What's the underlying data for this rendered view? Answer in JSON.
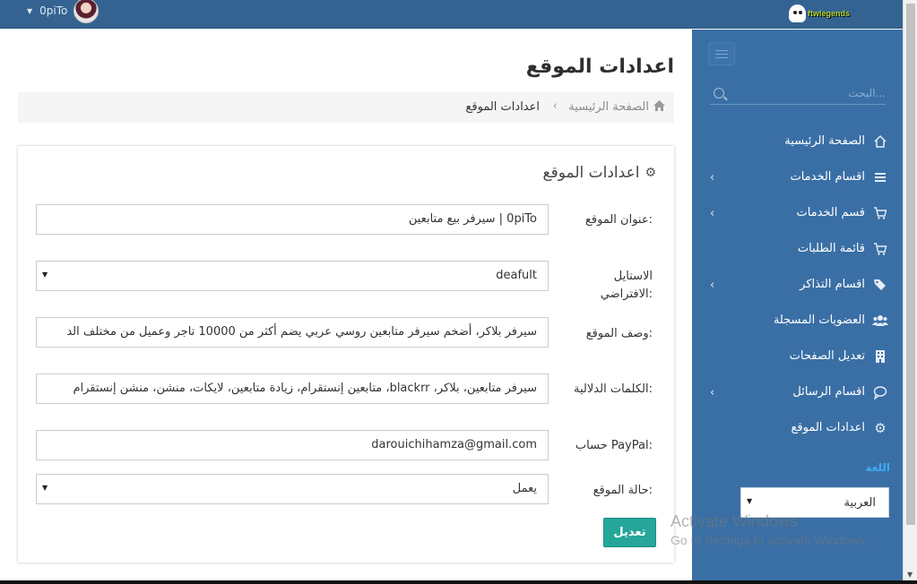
{
  "topbar": {
    "username": "0piTo",
    "logo_text": "ftwlegends"
  },
  "sidebar": {
    "search_placeholder": "البحث...",
    "items": [
      {
        "label": "الصفحة الرئيسية",
        "icon": "home-icon",
        "expandable": false
      },
      {
        "label": "اقسام الخدمات",
        "icon": "list-icon",
        "expandable": true
      },
      {
        "label": "قسم الخدمات",
        "icon": "cart-icon",
        "expandable": true
      },
      {
        "label": "قائمة الطلبات",
        "icon": "cart-icon",
        "expandable": false
      },
      {
        "label": "اقسام التذاكر",
        "icon": "tags-icon",
        "expandable": true
      },
      {
        "label": "العضويات المسجلة",
        "icon": "users-icon",
        "expandable": false
      },
      {
        "label": "تعديل الصفحات",
        "icon": "building-icon",
        "expandable": false
      },
      {
        "label": "اقسام الرسائل",
        "icon": "chat-icon",
        "expandable": true
      },
      {
        "label": "اعدادات الموقع",
        "icon": "gear-icon",
        "expandable": false
      }
    ],
    "language_label": "اللغة",
    "language_value": "العربية"
  },
  "main": {
    "page_title": "اعدادات الموقع",
    "breadcrumb": {
      "home": "الصفحة الرئيسية",
      "current": "اعدادات الموقع"
    },
    "card": {
      "title": "اعدادات الموقع",
      "fields": {
        "site_title": {
          "label": "عنوان الموقع:",
          "value": "0piTo | سيرفر بيع متابعين"
        },
        "default_style": {
          "label": "الاستايل الافتراضي:",
          "value": "deafult"
        },
        "site_description": {
          "label": "وصف الموقع:",
          "value": "سيرفر بلاكر، أضخم سيرفر متابعين روسي عربي يضم أكثر من 10000 تاجر وعميل من مختلف الد"
        },
        "keywords": {
          "label": "الكلمات الدلالية:",
          "value": "سيرفر متابعين، بلاكر، blackrr، متابعين إنستقرام، زيادة متابعين، لايكات، منشن، منشن إنستقرام"
        },
        "paypal": {
          "label": "حساب PayPal:",
          "value": "darouichihamza@gmail.com"
        },
        "site_status": {
          "label": "حالة الموقع:",
          "value": "يعمل"
        }
      },
      "save_label": "تعديل"
    }
  },
  "watermark": {
    "line1": "Activate Windows",
    "line2": "Go to Settings to activate Windows."
  },
  "colors": {
    "topbar": "#346392",
    "sidebar": "#3a6fa5",
    "accent_button": "#26a69a",
    "language_label": "#3fa9f5"
  }
}
